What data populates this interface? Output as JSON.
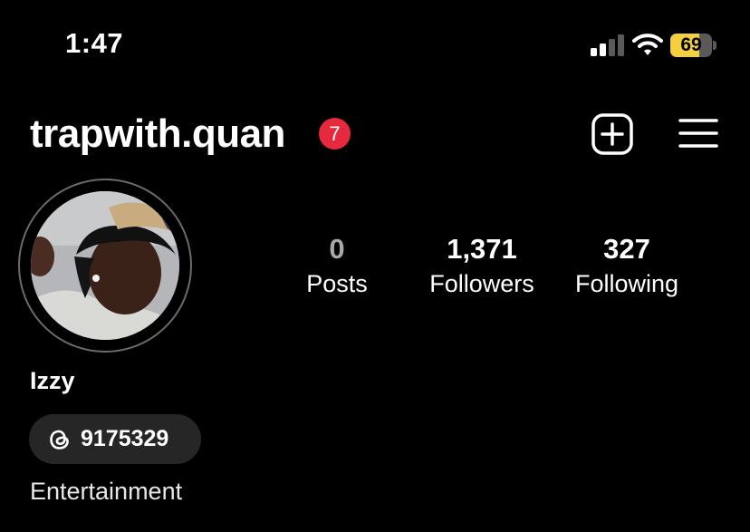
{
  "status_bar": {
    "time": "1:47",
    "battery_level": "69",
    "battery_color": "#f4cf3f",
    "signal_bars_active": 2,
    "signal_bars_total": 4
  },
  "header": {
    "username": "trapwith.quan",
    "notification_count": "7",
    "badge_color": "#e6293c",
    "add_icon": "plus-square-icon",
    "menu_icon": "hamburger-menu-icon"
  },
  "profile": {
    "avatar_icon": "profile-photo",
    "display_name": "Izzy",
    "threads_icon": "threads-icon",
    "threads_handle": "9175329",
    "category": "Entertainment"
  },
  "stats": [
    {
      "value": "0",
      "label": "Posts"
    },
    {
      "value": "1,371",
      "label": "Followers"
    },
    {
      "value": "327",
      "label": "Following"
    }
  ]
}
